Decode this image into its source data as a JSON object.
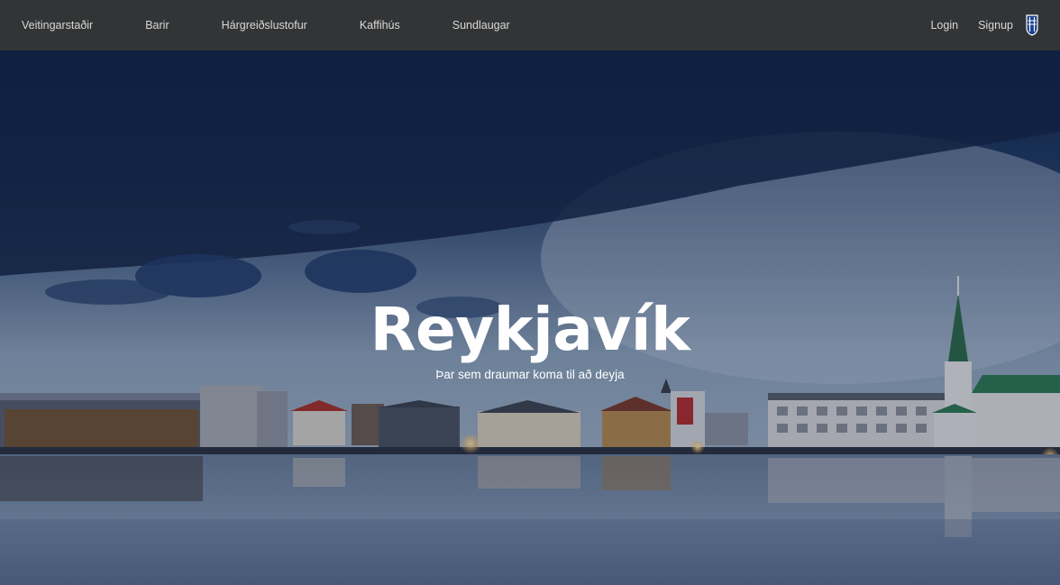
{
  "nav": {
    "links": [
      {
        "label": "Veitingarstaðir"
      },
      {
        "label": "Barir"
      },
      {
        "label": "Hárgreiðslustofur"
      },
      {
        "label": "Kaffihús"
      },
      {
        "label": "Sundlaugar"
      }
    ],
    "login_label": "Login",
    "signup_label": "Signup",
    "logo_icon": "reykjavik-crest-icon"
  },
  "hero": {
    "title": "Reykjavík",
    "subtitle": "Þar sem draumar koma til að deyja"
  },
  "colors": {
    "navbar_bg": "#333435",
    "nav_text": "#d8d8d8",
    "hero_text": "#ffffff",
    "sky_dark": "#1d3559",
    "sky_light": "#8aa2bd"
  }
}
